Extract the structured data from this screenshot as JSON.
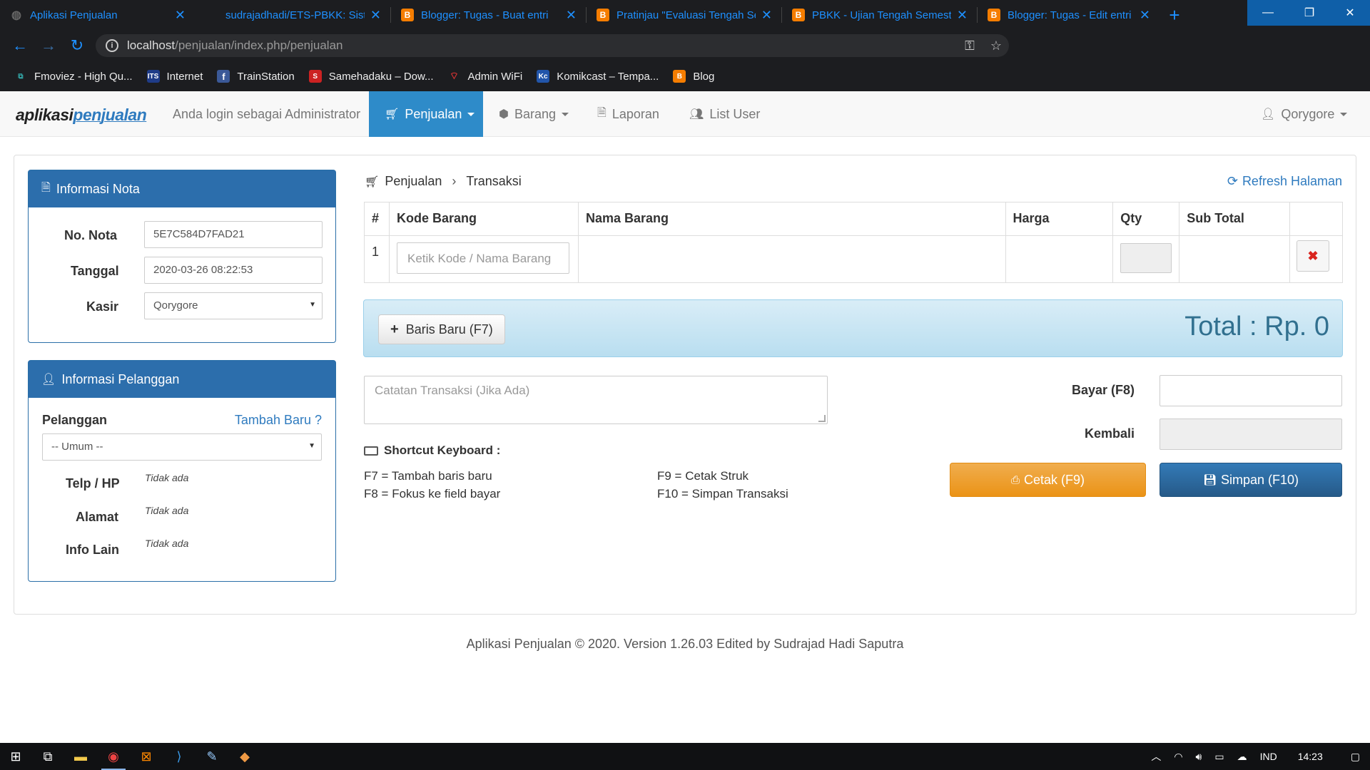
{
  "browser": {
    "tabs": [
      {
        "title": "Aplikasi Penjualan",
        "icon": "app-icon"
      },
      {
        "title": "sudrajadhadi/ETS-PBKK: Siste",
        "icon": "github-icon"
      },
      {
        "title": "Blogger: Tugas - Buat entri",
        "icon": "blogger-icon"
      },
      {
        "title": "Pratinjau \"Evaluasi Tengah Se",
        "icon": "blogger-icon"
      },
      {
        "title": "PBKK - Ujian Tengah Semeste",
        "icon": "blogger-icon"
      },
      {
        "title": "Blogger: Tugas - Edit entri",
        "icon": "blogger-icon"
      }
    ],
    "url_host": "localhost",
    "url_path": "/penjualan/index.php/penjualan",
    "bookmarks": [
      {
        "label": "Fmoviez - High Qu...",
        "icon": "fmoviez-icon"
      },
      {
        "label": "Internet",
        "icon": "its-icon"
      },
      {
        "label": "TrainStation",
        "icon": "facebook-icon"
      },
      {
        "label": "Samehadaku – Dow...",
        "icon": "samehadaku-icon"
      },
      {
        "label": "Admin WiFi",
        "icon": "wifi-icon"
      },
      {
        "label": "Komikcast – Tempa...",
        "icon": "komikcast-icon"
      },
      {
        "label": "Blog",
        "icon": "blogger-icon"
      }
    ]
  },
  "navbar": {
    "brand_part1": "aplikasi",
    "brand_part2": "penjualan",
    "login_text": "Anda login sebagai Administrator",
    "items": [
      {
        "label": "Penjualan",
        "icon": "cart-icon",
        "active": true
      },
      {
        "label": "Barang",
        "icon": "cube-icon"
      },
      {
        "label": "Laporan",
        "icon": "file-icon"
      },
      {
        "label": "List User",
        "icon": "users-icon"
      }
    ],
    "user": "Qorygore"
  },
  "nota": {
    "heading": "Informasi Nota",
    "no_label": "No. Nota",
    "no_value": "5E7C584D7FAD21",
    "tanggal_label": "Tanggal",
    "tanggal_value": "2020-03-26 08:22:53",
    "kasir_label": "Kasir",
    "kasir_value": "Qorygore"
  },
  "pelanggan": {
    "heading": "Informasi Pelanggan",
    "label": "Pelanggan",
    "add_link": "Tambah Baru ?",
    "select_value": "-- Umum --",
    "telp_label": "Telp / HP",
    "telp_value": "Tidak ada",
    "alamat_label": "Alamat",
    "alamat_value": "Tidak ada",
    "info_label": "Info Lain",
    "info_value": "Tidak ada"
  },
  "breadcrumb": {
    "root": "Penjualan",
    "sep": "›",
    "current": "Transaksi"
  },
  "refresh_label": "Refresh Halaman",
  "table": {
    "headers": [
      "#",
      "Kode Barang",
      "Nama Barang",
      "Harga",
      "Qty",
      "Sub Total",
      ""
    ],
    "rows": [
      {
        "no": "1",
        "kode_placeholder": "Ketik Kode / Nama Barang",
        "nama": "",
        "harga": "",
        "subtotal": ""
      }
    ],
    "delete_glyph": "✖"
  },
  "add_row_label": "Baris Baru (F7)",
  "total_text": "Total : Rp. 0",
  "note_placeholder": "Catatan Transaksi (Jika Ada)",
  "shortcuts": {
    "title": "Shortcut Keyboard :",
    "items": [
      "F7 = Tambah baris baru",
      "F8 = Fokus ke field bayar",
      "F9 = Cetak Struk",
      "F10 = Simpan Transaksi"
    ]
  },
  "payment": {
    "bayar_label": "Bayar (F8)",
    "kembali_label": "Kembali",
    "cetak_label": "Cetak (F9)",
    "simpan_label": "Simpan (F10)"
  },
  "footer": "Aplikasi Penjualan © 2020. Version 1.26.03 Edited by Sudrajad Hadi Saputra",
  "taskbar": {
    "lang": "IND",
    "time": "14:23"
  },
  "colors": {
    "nav_active": "#2e8bc9",
    "box_header": "#2c6eac",
    "total_bg": "#d9edf7",
    "cetak": "#f0ad4e",
    "simpan": "#337ab7",
    "link": "#2f7bbf"
  }
}
